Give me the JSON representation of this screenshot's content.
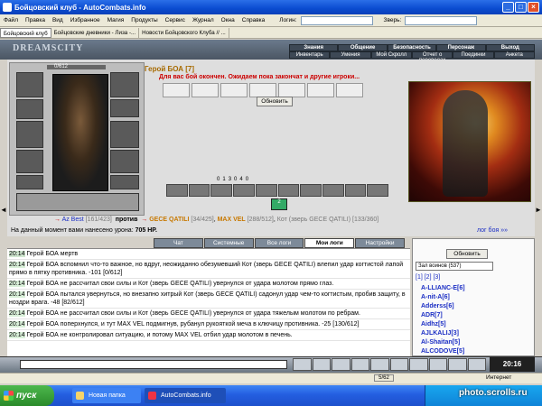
{
  "window": {
    "title": "Бойцовский клуб - AutoCombats.info"
  },
  "menu": {
    "items": [
      "Файл",
      "Правка",
      "Вид",
      "Избранное",
      "Магия",
      "Продукты",
      "Сервис",
      "Журнал",
      "Окна",
      "Справка"
    ],
    "login_label": "Логин:",
    "beast_label": "Зверь:"
  },
  "tabs": [
    "Бойцовский клуб",
    "Бойцовские дневники - Лиза -...",
    "Новости Бойцовского Клуба // ..."
  ],
  "game": {
    "logo": "DREAMSCITY",
    "nav_top": [
      "Знания",
      "Общение",
      "Безопасность",
      "Персонаж",
      "Выход"
    ],
    "nav_bottom": [
      "Инвентарь",
      "Умения",
      "Мой Скролл",
      "Отчет о переводах",
      "Поединки",
      "Анкета"
    ],
    "hp": "0/612",
    "hero": "Герой БОА [7]",
    "wait_message": "Для вас бой окончен. Ожидаем пока закончат и другие игроки...",
    "ok_button": "Обновить",
    "stats": [
      "0",
      "1",
      "3",
      "0",
      "4",
      "0"
    ],
    "counter": "2",
    "battle": {
      "left_name": "Az Best",
      "left_hp": "[161/423]",
      "vs": "против",
      "r1_name": "GECE QATILI",
      "r1_hp": "[34/425]",
      "r2_name": "MAX VEL",
      "r2_hp": "[288/512]",
      "r3_name": "Кот (зверь GECE QATILI)",
      "r3_hp": "[133/360]"
    },
    "damage_text": "На данный момент вами нанесено урона:",
    "damage_value": "705 HP.",
    "battle_log_link": "лог боя »»"
  },
  "chat": {
    "tabs": [
      "Чат",
      "Системные сообщения",
      "Все логи",
      "Мои логи",
      "Настройки"
    ],
    "lines": [
      {
        "time": "20:14",
        "text": "Герой БОА мертв"
      },
      {
        "time": "20:14",
        "text": "Герой БОА вспомнил что-то важное, но вдруг, неожиданно обезумевший Кот (зверь GECE QATILI) влепил удар когтистой лапой прямо в пятку противника. -101 [0/612]"
      },
      {
        "time": "20:14",
        "text": "Герой БОА не рассчитал свои силы и Кот (зверь GECE QATILI) увернулся от удара молотом прямо глаз."
      },
      {
        "time": "20:14",
        "text": "Герой БОА пытался увернуться, но внезапно хитрый Кот (зверь GECE QATILI) садонул удар чем-то когтистым, пробив защиту, в ноздри врага. -48 [82/612]"
      },
      {
        "time": "20:14",
        "text": "Герой БОА не рассчитал свои силы и Кот (зверь GECE QATILI) увернулся от удара тяжелым молотом по ребрам."
      },
      {
        "time": "20:14",
        "text": "Герой БОА поперхнулся, и тут MAX VEL подмигнув, рубанул рукояткой меча в ключицу противника. -25 [130/612]"
      },
      {
        "time": "20:14",
        "text": "Герой БОА не контролировал ситуацию, и потому MAX VEL отбил удар молотом в печень."
      }
    ]
  },
  "sidebar": {
    "refresh": "Обновить",
    "sort": "Зал воинов (537)",
    "pages": "[1] [2] [3]",
    "players": [
      "A-LLIANC-E[6]",
      "A-nit-A[6]",
      "Adderss[6]",
      "ADR[7]",
      "Aidhz[5]",
      "AJLKALIJ[3]",
      "Al-Shaitan[5]",
      "ALCODOVE[5]"
    ]
  },
  "toolbar": {
    "clock": "20:16"
  },
  "status": {
    "number": "5/62",
    "zone": "Интернет"
  },
  "taskbar": {
    "start": "пуск",
    "items": [
      "Новая папка",
      "AutoCombats.info"
    ],
    "watermark": "photo.scrolls.ru"
  }
}
